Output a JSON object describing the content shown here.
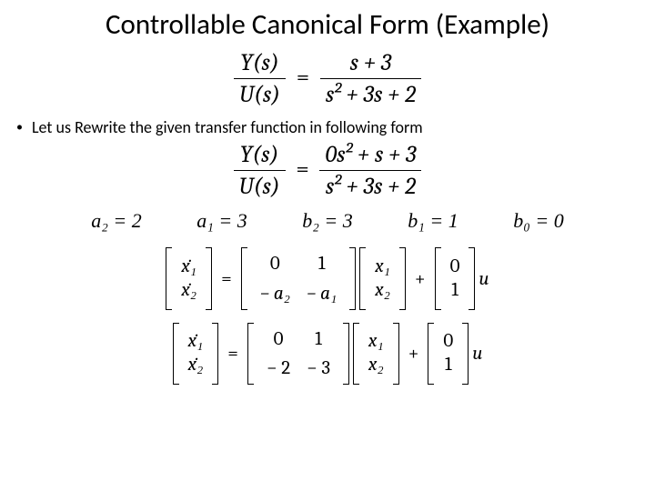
{
  "title": "Controllable Canonical Form (Example)",
  "bullet": "Let us Rewrite the given transfer function in following form",
  "tf1": {
    "lhs_num": "Y(s)",
    "lhs_den": "U(s)",
    "rhs_num": "s + 3",
    "rhs_den": "s² + 3s + 2"
  },
  "tf2": {
    "lhs_num": "Y(s)",
    "lhs_den": "U(s)",
    "rhs_num": "0s² + s + 3",
    "rhs_den": "s² + 3s + 2"
  },
  "coeffs": {
    "a2": "a₂ = 2",
    "a1": "a₁ = 3",
    "b2": "b₂ = 3",
    "b1": "b₁ = 1",
    "b0": "b₀ = 0"
  },
  "sym": {
    "x1d": "ẋ₁",
    "x2d": "ẋ₂",
    "x1": "x₁",
    "x2": "x₂",
    "eq": "=",
    "plus": "+",
    "u": "u",
    "zero": "0",
    "one": "1",
    "neg_a2": "− a₂",
    "neg_a1": "− a₁",
    "neg2": "− 2",
    "neg3": "− 3"
  }
}
